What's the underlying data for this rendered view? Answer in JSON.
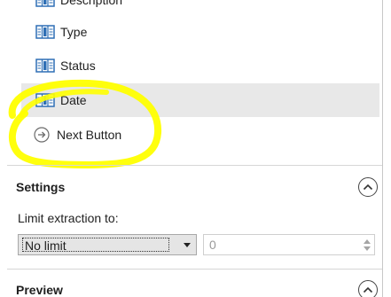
{
  "fields": {
    "items": [
      {
        "label": "Description",
        "icon": "table-column-icon"
      },
      {
        "label": "Type",
        "icon": "table-column-icon"
      },
      {
        "label": "Status",
        "icon": "table-column-icon"
      },
      {
        "label": "Date",
        "icon": "table-column-icon",
        "selected": true
      }
    ],
    "next_button": {
      "label": "Next Button",
      "icon": "arrow-right-circle-icon"
    }
  },
  "settings": {
    "title": "Settings",
    "limit_label": "Limit extraction to:",
    "limit_select_value": "No limit",
    "limit_number_value": "0"
  },
  "preview": {
    "title": "Preview"
  },
  "colors": {
    "highlight": "#ffff00",
    "selected_row": "#e8e8e8",
    "icon_blue": "#2f6fb5"
  }
}
